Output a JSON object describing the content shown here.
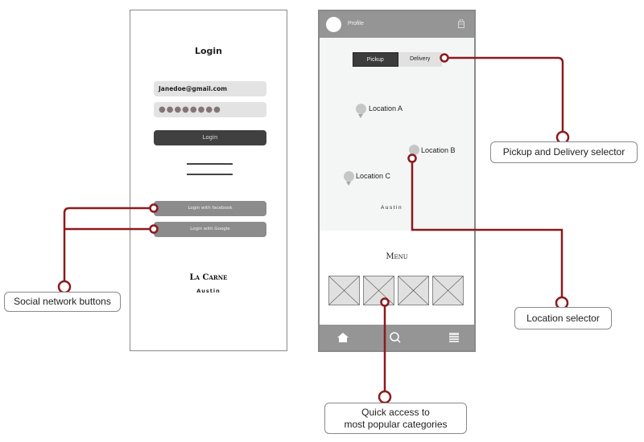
{
  "login_screen": {
    "title": "Login",
    "email_value": "Janedoe@gmail.com",
    "password_value": "●●●●●●●●",
    "login_button": "Login",
    "facebook_button": "Login with facebook",
    "google_button": "Login with Google",
    "brand": "La Carne",
    "city": "Austin"
  },
  "main_screen": {
    "profile_label": "Profile",
    "header_icon": "shopping-bag-icon",
    "segmented": {
      "options": [
        "Pickup",
        "Delivery"
      ],
      "selected": "Pickup"
    },
    "locations": [
      {
        "label": "Location A"
      },
      {
        "label": "Location B"
      },
      {
        "label": "Location C"
      }
    ],
    "map_city": "Austin",
    "menu_title": "Menu",
    "category_count": 4,
    "bottom_nav": [
      {
        "icon": "home-icon"
      },
      {
        "icon": "search-icon"
      },
      {
        "icon": "list-icon"
      }
    ]
  },
  "annotations": {
    "color": "#8b1a1e",
    "social": "Social network buttons",
    "pickup_delivery": "Pickup and Delivery selector",
    "location": "Location selector",
    "quick_access_line1": "Quick access to",
    "quick_access_line2": "most popular categories"
  }
}
